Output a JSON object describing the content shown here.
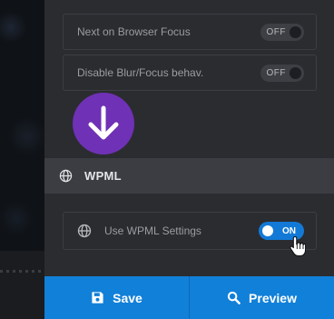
{
  "settings": {
    "browser_focus": {
      "label": "Next on Browser Focus",
      "state": "OFF"
    },
    "blur_focus": {
      "label": "Disable Blur/Focus behav.",
      "state": "OFF"
    }
  },
  "section": {
    "title": "WPML"
  },
  "wpml": {
    "label": "Use WPML Settings",
    "state": "ON"
  },
  "footer": {
    "save_label": "Save",
    "preview_label": "Preview"
  },
  "colors": {
    "panel": "#2b2c30",
    "accent": "#1180d9",
    "toggle_on": "#1379d6",
    "badge": "#6f31b5"
  }
}
